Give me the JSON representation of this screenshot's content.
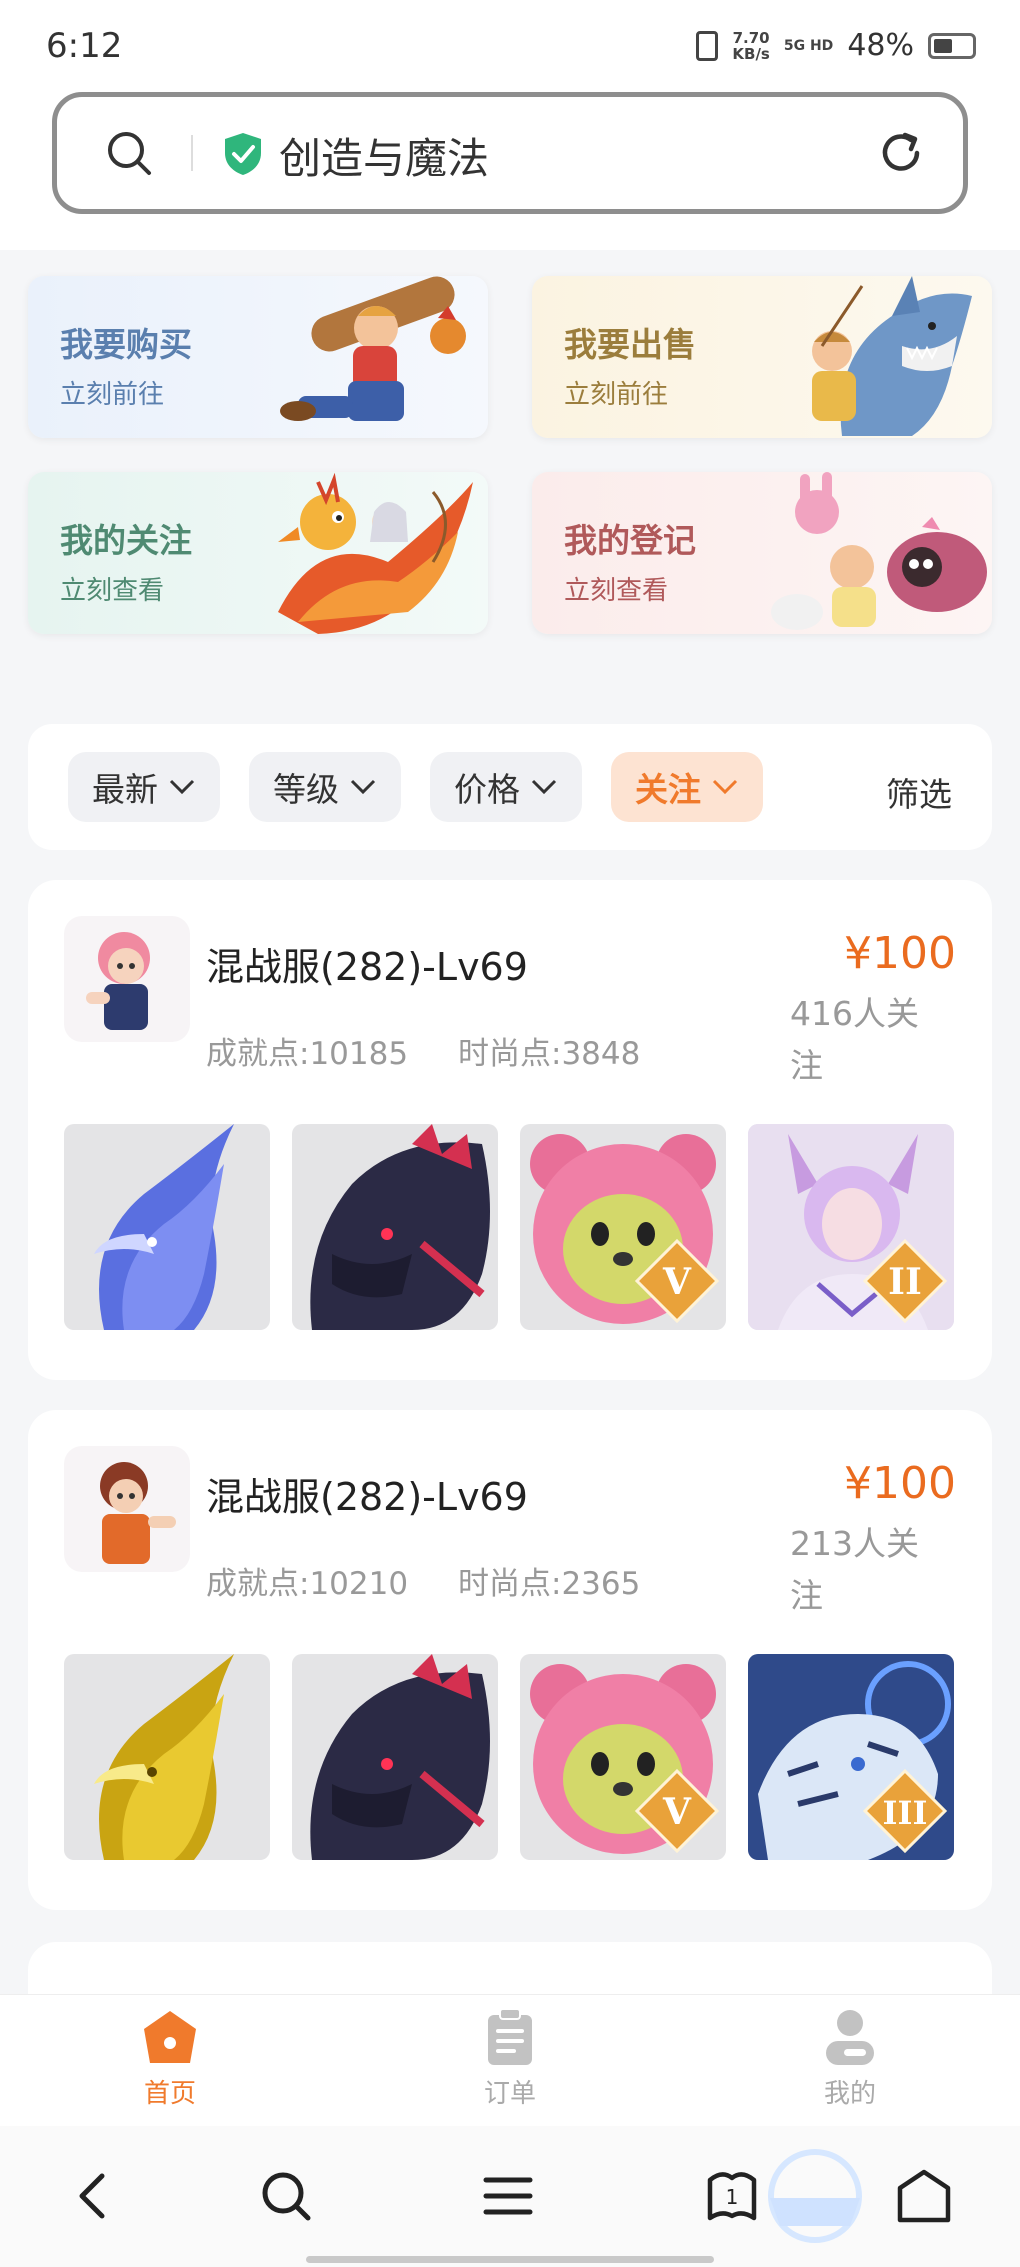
{
  "status_bar": {
    "time": "6:12",
    "net_speed_top": "7.70",
    "net_speed_bottom": "KB/s",
    "signal": "5G HD",
    "battery": "48%"
  },
  "search": {
    "query": "创造与魔法"
  },
  "entries": [
    {
      "label": "我要购买",
      "sub": "立刻前往"
    },
    {
      "label": "我要出售",
      "sub": "立刻前往"
    },
    {
      "label": "我的关注",
      "sub": "立刻查看"
    },
    {
      "label": "我的登记",
      "sub": "立刻查看"
    }
  ],
  "filters": {
    "chips": [
      "最新",
      "等级",
      "价格",
      "关注"
    ],
    "active": "关注",
    "filter_label": "筛选"
  },
  "listings": [
    {
      "name": "混战服(282)-Lv69",
      "achievement": "成就点:10185",
      "fashion": "时尚点:3848",
      "price": "¥100",
      "follow_line1": "416人关",
      "follow_line2": "注",
      "badges": [
        "",
        "",
        "V",
        "II"
      ]
    },
    {
      "name": "混战服(282)-Lv69",
      "achievement": "成就点:10210",
      "fashion": "时尚点:2365",
      "price": "¥100",
      "follow_line1": "213人关",
      "follow_line2": "注",
      "badges": [
        "",
        "",
        "V",
        "III"
      ]
    }
  ],
  "tabs": [
    {
      "label": "首页",
      "icon": "home-icon"
    },
    {
      "label": "订单",
      "icon": "clipboard-icon"
    },
    {
      "label": "我的",
      "icon": "user-icon"
    }
  ],
  "colors": {
    "accent": "#f07a2c",
    "price": "#ea6b1f"
  }
}
